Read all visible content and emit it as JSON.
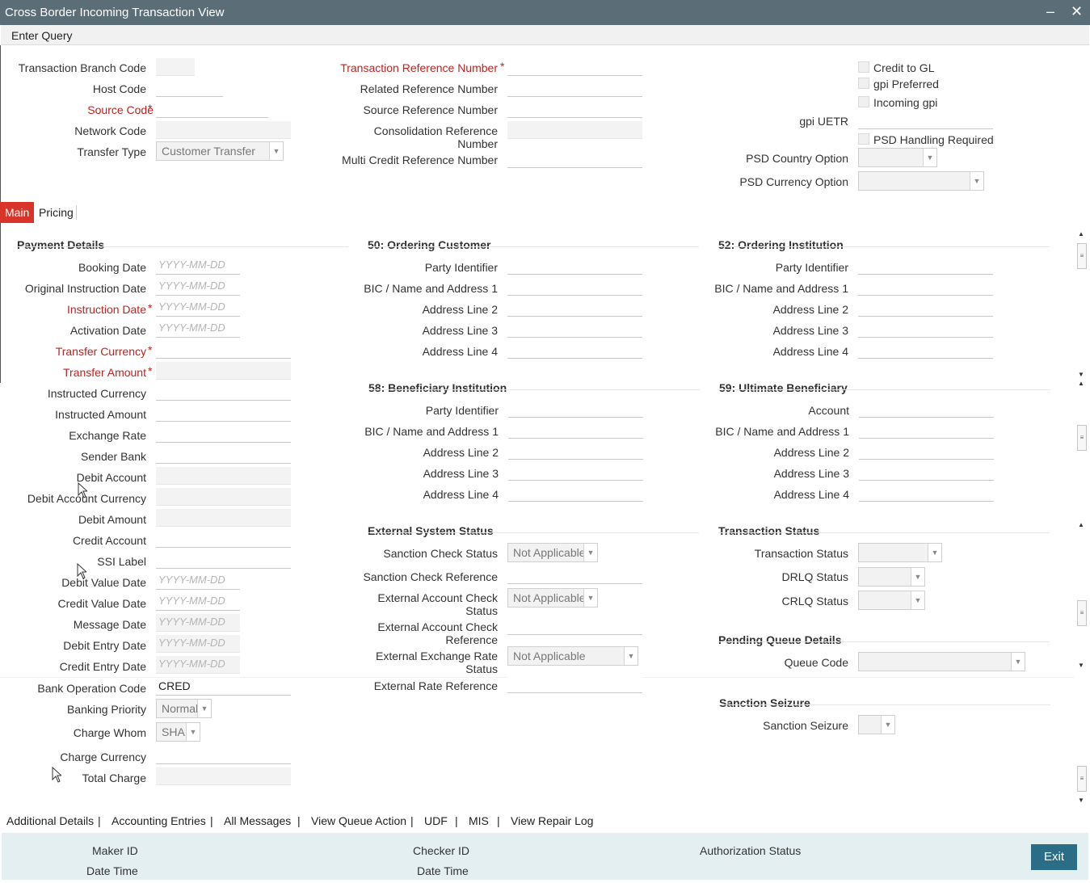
{
  "window": {
    "title": "Cross Border Incoming Transaction View",
    "minimize_icon": "minimize-icon",
    "close_icon": "close-icon"
  },
  "menu": {
    "enter_query": "Enter Query"
  },
  "header": {
    "branch_code_label": "Transaction Branch Code",
    "host_code_label": "Host Code",
    "source_code_label": "Source Code",
    "network_code_label": "Network Code",
    "transfer_type_label": "Transfer Type",
    "transfer_type_value": "Customer Transfer",
    "txn_ref_label": "Transaction Reference Number",
    "related_ref_label": "Related Reference Number",
    "source_ref_label": "Source Reference Number",
    "consolidation_ref_label": "Consolidation Reference Number",
    "multi_credit_ref_label": "Multi Credit Reference Number",
    "credit_to_gl": "Credit to GL",
    "gpi_preferred": "gpi Preferred",
    "incoming_gpi": "Incoming gpi",
    "gpi_uetr_label": "gpi UETR",
    "psd_handling": "PSD Handling Required",
    "psd_country_label": "PSD Country Option",
    "psd_currency_label": "PSD Currency Option"
  },
  "tabs": [
    "Main",
    "Pricing"
  ],
  "date_placeholder": "YYYY-MM-DD",
  "payment": {
    "title": "Payment Details",
    "booking_date": "Booking Date",
    "original_instruction_date": "Original Instruction Date",
    "instruction_date": "Instruction Date",
    "activation_date": "Activation Date",
    "transfer_currency": "Transfer Currency",
    "transfer_amount": "Transfer Amount",
    "instructed_currency": "Instructed Currency",
    "instructed_amount": "Instructed Amount",
    "exchange_rate": "Exchange Rate",
    "sender_bank": "Sender Bank",
    "debit_account": "Debit Account",
    "debit_account_currency": "Debit Account Currency",
    "debit_amount": "Debit Amount",
    "credit_account": "Credit Account",
    "ssi_label": "SSI Label",
    "debit_value_date": "Debit Value Date",
    "credit_value_date": "Credit Value Date",
    "message_date": "Message Date",
    "debit_entry_date": "Debit Entry Date",
    "credit_entry_date": "Credit Entry Date",
    "bank_operation_code": "Bank Operation Code",
    "bank_operation_code_value": "CRED",
    "banking_priority": "Banking Priority",
    "banking_priority_value": "Normal",
    "charge_whom": "Charge Whom",
    "charge_whom_value": "SHA",
    "charge_currency": "Charge Currency",
    "total_charge": "Total Charge"
  },
  "ordering_customer": {
    "title": "50: Ordering Customer",
    "party_identifier": "Party Identifier",
    "bic": "BIC / Name and Address 1",
    "addr2": "Address Line 2",
    "addr3": "Address Line 3",
    "addr4": "Address Line 4"
  },
  "ordering_institution": {
    "title": "52: Ordering Institution",
    "party_identifier": "Party Identifier",
    "bic": "BIC / Name and Address 1",
    "addr2": "Address Line 2",
    "addr3": "Address Line 3",
    "addr4": "Address Line 4"
  },
  "beneficiary_institution": {
    "title": "58: Beneficiary Institution",
    "party_identifier": "Party Identifier",
    "bic": "BIC / Name and Address 1",
    "addr2": "Address Line 2",
    "addr3": "Address Line 3",
    "addr4": "Address Line 4"
  },
  "ultimate_beneficiary": {
    "title": "59: Ultimate Beneficiary",
    "account": "Account",
    "bic": "BIC / Name and Address 1",
    "addr2": "Address Line 2",
    "addr3": "Address Line 3",
    "addr4": "Address Line 4"
  },
  "external_status": {
    "title": "External System Status",
    "sanction_check_status": "Sanction Check Status",
    "sanction_check_status_value": "Not Applicable",
    "sanction_check_reference": "Sanction Check Reference",
    "ext_account_check_status": "External Account Check Status",
    "ext_account_check_status_value": "Not Applicable",
    "ext_account_check_reference": "External Account Check Reference",
    "ext_exchange_rate_status": "External Exchange Rate Status",
    "ext_exchange_rate_status_value": "Not Applicable",
    "external_rate_reference": "External Rate Reference"
  },
  "transaction_status": {
    "title": "Transaction Status",
    "transaction_status": "Transaction Status",
    "drlq_status": "DRLQ Status",
    "crlq_status": "CRLQ Status"
  },
  "pending_queue": {
    "title": "Pending Queue Details",
    "queue_code": "Queue Code"
  },
  "sanction_seizure": {
    "title": "Sanction Seizure",
    "label": "Sanction Seizure"
  },
  "bottom_links": [
    "Additional Details",
    "|",
    "Accounting Entries",
    "|",
    "All Messages",
    "|",
    "View Queue Action",
    "|",
    "UDF",
    "|",
    "MIS",
    "|",
    "View Repair Log"
  ],
  "footer": {
    "maker_id": "Maker ID",
    "date_time_1": "Date Time",
    "checker_id": "Checker ID",
    "date_time_2": "Date Time",
    "authorization_status": "Authorization Status",
    "exit": "Exit"
  }
}
